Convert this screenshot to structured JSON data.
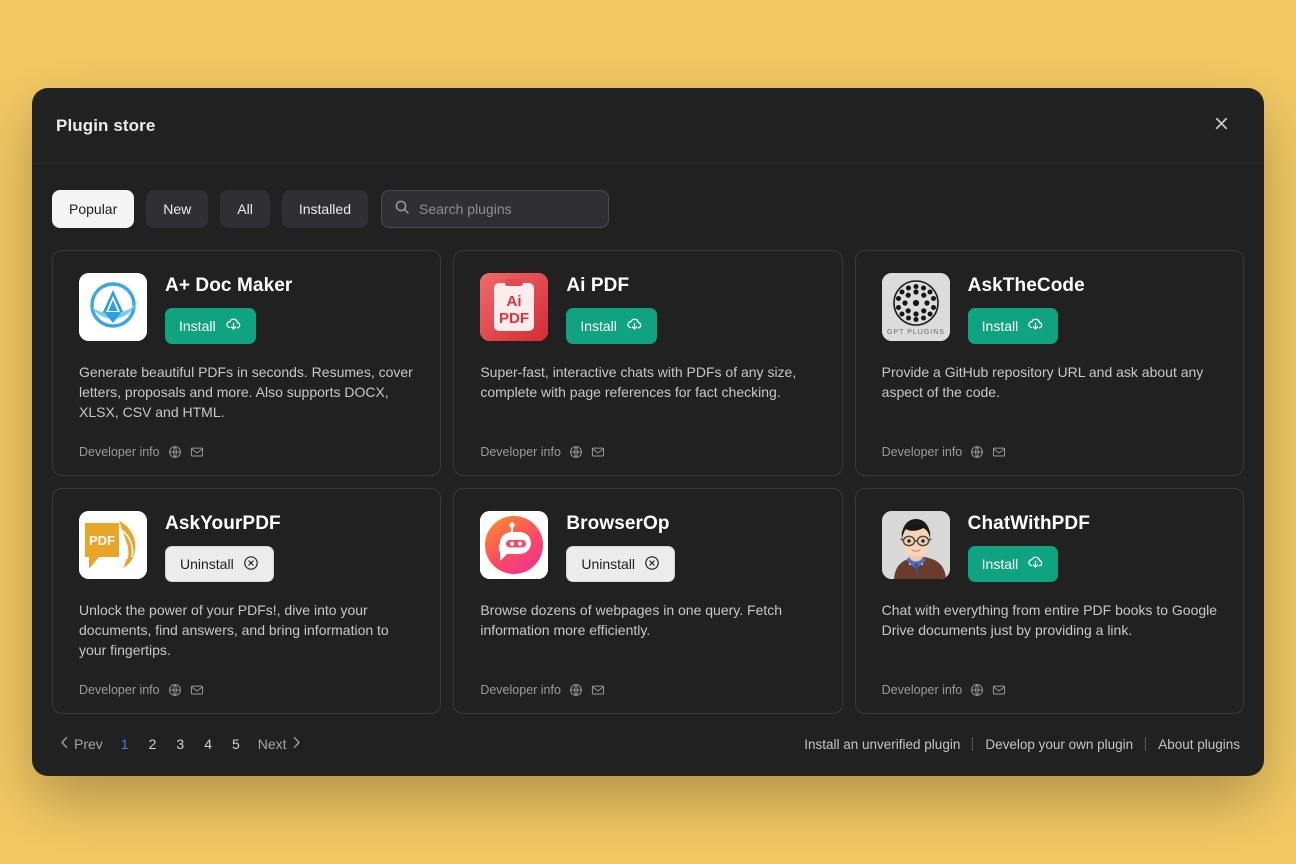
{
  "window": {
    "title": "Plugin store",
    "close_icon": "close-icon",
    "background_color": "#f3c964",
    "panel_color": "#212121",
    "accent_install": "#10a37f",
    "accent_page_current": "#4b7bec"
  },
  "toolbar": {
    "filters": [
      {
        "label": "Popular",
        "active": true
      },
      {
        "label": "New",
        "active": false
      },
      {
        "label": "All",
        "active": false
      },
      {
        "label": "Installed",
        "active": false
      }
    ],
    "search": {
      "placeholder": "Search plugins",
      "value": "",
      "icon": "search-icon"
    }
  },
  "plugins": [
    {
      "name": "A+ Doc Maker",
      "icon": "a-plus-doc-maker-icon",
      "action": {
        "label": "Install",
        "state": "install",
        "icon": "cloud-download-icon"
      },
      "description": "Generate beautiful PDFs in seconds. Resumes, cover letters, proposals and more. Also supports DOCX, XLSX, CSV and HTML.",
      "developer_info": {
        "label": "Developer info",
        "website_icon": "globe-icon",
        "email_icon": "envelope-icon"
      }
    },
    {
      "name": "Ai PDF",
      "icon": "ai-pdf-icon",
      "action": {
        "label": "Install",
        "state": "install",
        "icon": "cloud-download-icon"
      },
      "description": "Super-fast, interactive chats with PDFs of any size, complete with page references for fact checking.",
      "developer_info": {
        "label": "Developer info",
        "website_icon": "globe-icon",
        "email_icon": "envelope-icon"
      }
    },
    {
      "name": "AskTheCode",
      "icon": "askthecode-gpt-plugins-icon",
      "action": {
        "label": "Install",
        "state": "install",
        "icon": "cloud-download-icon"
      },
      "description": "Provide a GitHub repository URL and ask about any aspect of the code.",
      "developer_info": {
        "label": "Developer info",
        "website_icon": "globe-icon",
        "email_icon": "envelope-icon"
      }
    },
    {
      "name": "AskYourPDF",
      "icon": "askyourpdf-icon",
      "action": {
        "label": "Uninstall",
        "state": "uninstall",
        "icon": "circle-x-icon"
      },
      "description": "Unlock the power of your PDFs!, dive into your documents, find answers, and bring information to your fingertips.",
      "developer_info": {
        "label": "Developer info",
        "website_icon": "globe-icon",
        "email_icon": "envelope-icon"
      }
    },
    {
      "name": "BrowserOp",
      "icon": "browserop-robot-icon",
      "action": {
        "label": "Uninstall",
        "state": "uninstall",
        "icon": "circle-x-icon"
      },
      "description": "Browse dozens of webpages in one query. Fetch information more efficiently.",
      "developer_info": {
        "label": "Developer info",
        "website_icon": "globe-icon",
        "email_icon": "envelope-icon"
      }
    },
    {
      "name": "ChatWithPDF",
      "icon": "chatwithpdf-avatar-icon",
      "action": {
        "label": "Install",
        "state": "install",
        "icon": "cloud-download-icon"
      },
      "description": "Chat with everything from entire PDF books to Google Drive documents just by providing a link.",
      "developer_info": {
        "label": "Developer info",
        "website_icon": "globe-icon",
        "email_icon": "envelope-icon"
      }
    }
  ],
  "pagination": {
    "prev_label": "Prev",
    "next_label": "Next",
    "pages": [
      "1",
      "2",
      "3",
      "4",
      "5"
    ],
    "current_page": "1"
  },
  "footer_links": [
    {
      "label": "Install an unverified plugin"
    },
    {
      "label": "Develop your own plugin"
    },
    {
      "label": "About plugins"
    }
  ]
}
